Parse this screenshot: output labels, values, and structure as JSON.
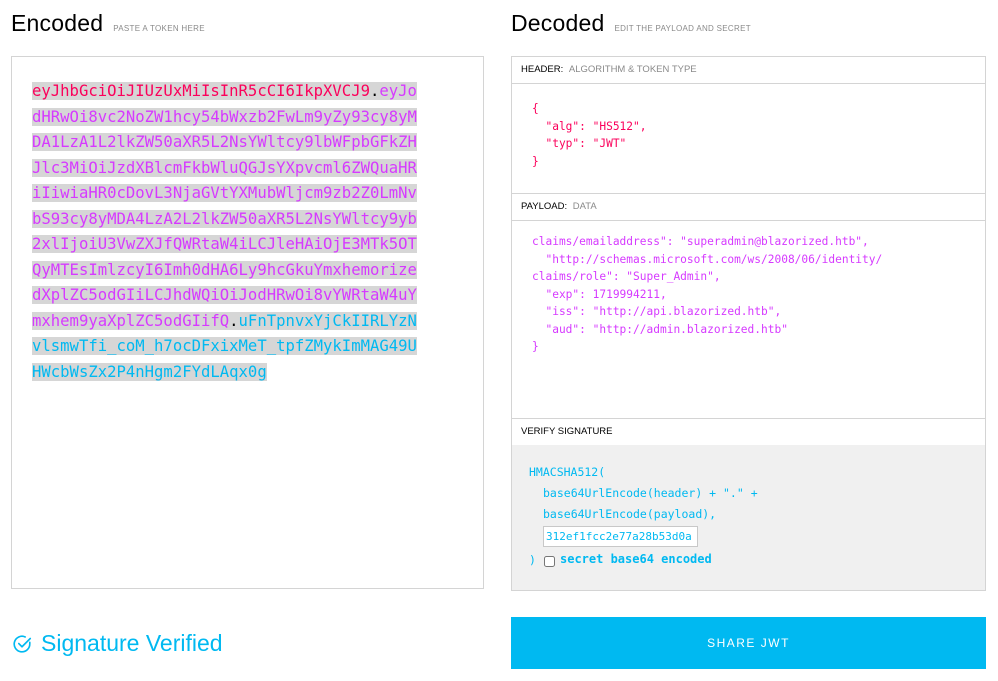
{
  "encoded": {
    "title": "Encoded",
    "subtitle": "PASTE A TOKEN HERE",
    "token": {
      "header": "eyJhbGciOiJIUzUxMiIsInR5cCI6IkpXVCJ9",
      "dot1": ".",
      "payload": "eyJodHRwOi8vc2NoZW1hcy54bWxzb2FwLm9yZy93cy8yMDA1LzA1L2lkZW50aXR5L2NsYWltcy9lbWFpbGFkZHJlc3MiOiJzdXBlcmFkbWluQGJsYXpvcml6ZWQuaHRiIiwiaHR0cDovL3NjaGVtYXMubWljcm9zb2Z0LmNvbS93cy8yMDA4LzA2L2lkZW50aXR5L2NsYWltcy9yb2xlIjoiU3VwZXJfQWRtaW4iLCJleHAiOjE3MTk5OTQyMTEsImlzcyI6Imh0dHA6Ly9hcGkuYmxhemorizedXplZC5odGIiLCJhdWQiOiJodHRwOi8vYWRtaW4uYmxhem9yaXplZC5odGIifQ",
      "dot2": ".",
      "signature": "uFnTpnvxYjCkIIRLYzNvlsmwTfi_coM_h7ocDFxixMeT_tpfZMykImMAG49UHWcbWsZx2P4nHgm2FYdLAqx0g"
    }
  },
  "decoded": {
    "title": "Decoded",
    "subtitle": "EDIT THE PAYLOAD AND SECRET",
    "header_section": {
      "label": "HEADER:",
      "sublabel": "ALGORITHM & TOKEN TYPE",
      "json": "{\n  \"alg\": \"HS512\",\n  \"typ\": \"JWT\"\n}"
    },
    "payload_section": {
      "label": "PAYLOAD:",
      "sublabel": "DATA",
      "json": "claims/emailaddress\": \"superadmin@blazorized.htb\",\n  \"http://schemas.microsoft.com/ws/2008/06/identity/\nclaims/role\": \"Super_Admin\",\n  \"exp\": 1719994211,\n  \"iss\": \"http://api.blazorized.htb\",\n  \"aud\": \"http://admin.blazorized.htb\"\n}"
    },
    "verify_section": {
      "label": "VERIFY SIGNATURE",
      "line1": "HMACSHA512(",
      "line2": "base64UrlEncode(header) + \".\" +",
      "line3": "base64UrlEncode(payload),",
      "secret_value": "312ef1fcc2e77a28b53d0a",
      "close": ")",
      "checkbox_label": "secret base64 encoded"
    }
  },
  "status": {
    "verified_text": "Signature Verified"
  },
  "share_button": "SHARE JWT",
  "colors": {
    "accent": "#00b9f1",
    "header_color": "#fb015b",
    "payload_color": "#d63aff"
  }
}
